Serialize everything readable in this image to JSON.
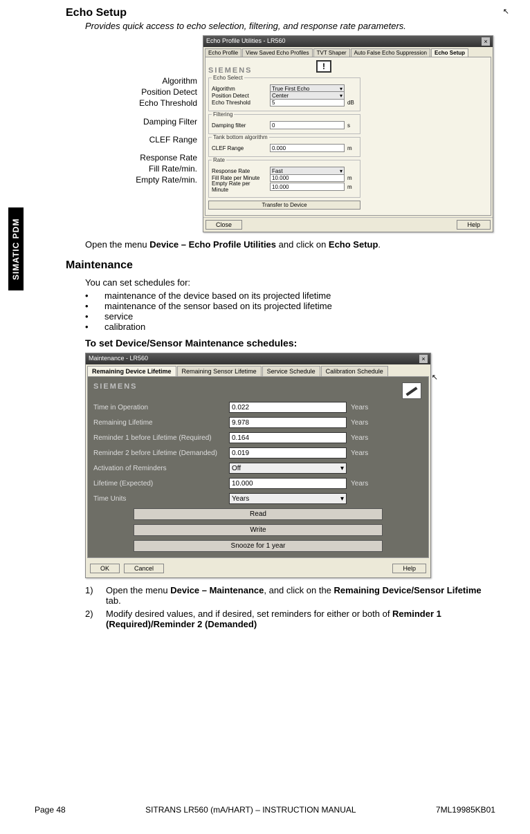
{
  "sideTab": "SIMATIC PDM",
  "echo": {
    "title": "Echo Setup",
    "subtitle": "Provides quick access to echo selection, filtering, and response rate parameters.",
    "callouts": {
      "algorithm": "Algorithm",
      "positionDetect": "Position Detect",
      "echoThreshold": "Echo Threshold",
      "dampingFilter": "Damping Filter",
      "clefRange": "CLEF Range",
      "responseRate": "Response Rate",
      "fillRate": "Fill Rate/min.",
      "emptyRate": "Empty Rate/min."
    },
    "dialog": {
      "title": "Echo Profile Utilities - LR560",
      "tabs": [
        "Echo Profile",
        "View Saved Echo Profiles",
        "TVT Shaper",
        "Auto False Echo Suppression",
        "Echo Setup"
      ],
      "activeTab": 4,
      "brand": "SIEMENS",
      "groups": {
        "echoSelect": {
          "legend": "Echo Select",
          "algorithm": {
            "label": "Algorithm",
            "value": "True First Echo"
          },
          "positionDetect": {
            "label": "Position Detect",
            "value": "Center"
          },
          "echoThreshold": {
            "label": "Echo Threshold",
            "value": "5",
            "unit": "dB"
          }
        },
        "filtering": {
          "legend": "Filtering",
          "dampingFilter": {
            "label": "Damping filter",
            "value": "0",
            "unit": "s"
          }
        },
        "tankBottom": {
          "legend": "Tank bottom algorithm",
          "clefRange": {
            "label": "CLEF Range",
            "value": "0.000",
            "unit": "m"
          }
        },
        "rate": {
          "legend": "Rate",
          "responseRate": {
            "label": "Response Rate",
            "value": "Fast"
          },
          "fillRate": {
            "label": "Fill Rate per Minute",
            "value": "10.000",
            "unit": "m"
          },
          "emptyRate": {
            "label": "Empty Rate per Minute",
            "value": "10.000",
            "unit": "m"
          }
        }
      },
      "transfer": "Transfer to Device",
      "close": "Close",
      "help": "Help"
    },
    "instruction": {
      "prefix": "Open the menu ",
      "b1": "Device – Echo Profile Utilities",
      "mid": " and click on ",
      "b2": "Echo Setup",
      "suffix": "."
    }
  },
  "maintenance": {
    "title": "Maintenance",
    "intro": "You can set schedules for:",
    "bullets": [
      "maintenance of the device based on its projected lifetime",
      "maintenance of the sensor based on its projected lifetime",
      "service",
      "calibration"
    ],
    "toset": "To set Device/Sensor Maintenance schedules:",
    "dialog": {
      "title": "Maintenance - LR560",
      "tabs": [
        "Remaining Device Lifetime",
        "Remaining Sensor Lifetime",
        "Service Schedule",
        "Calibration Schedule"
      ],
      "activeTab": 0,
      "brand": "SIEMENS",
      "rows": {
        "timeInOp": {
          "label": "Time in Operation",
          "value": "0.022",
          "unit": "Years"
        },
        "remaining": {
          "label": "Remaining Lifetime",
          "value": "9.978",
          "unit": "Years"
        },
        "rem1": {
          "label": "Reminder 1 before Lifetime (Required)",
          "value": "0.164",
          "unit": "Years"
        },
        "rem2": {
          "label": "Reminder 2 before Lifetime (Demanded)",
          "value": "0.019",
          "unit": "Years"
        },
        "activation": {
          "label": "Activation of Reminders",
          "value": "Off"
        },
        "expected": {
          "label": "Lifetime (Expected)",
          "value": "10.000",
          "unit": "Years"
        },
        "timeUnits": {
          "label": "Time Units",
          "value": "Years"
        }
      },
      "buttons": {
        "read": "Read",
        "write": "Write",
        "snooze": "Snooze for 1 year"
      },
      "ok": "OK",
      "cancel": "Cancel",
      "help": "Help"
    },
    "steps": [
      {
        "num": "1)",
        "prefix": "Open the menu ",
        "b1": "Device – Maintenance",
        "mid": ", and click on the ",
        "b2": "Remaining Device/Sensor Lifetime",
        "suffix": " tab."
      },
      {
        "num": "2)",
        "prefix": "Modify desired values, and if desired, set reminders for either or both of ",
        "b1": "Reminder 1 (Required)/Reminder 2 (Demanded)",
        "mid": "",
        "b2": "",
        "suffix": ""
      }
    ]
  },
  "footer": {
    "page": "Page 48",
    "center": "SITRANS LR560 (mA/HART) – INSTRUCTION MANUAL",
    "right": "7ML19985KB01"
  }
}
